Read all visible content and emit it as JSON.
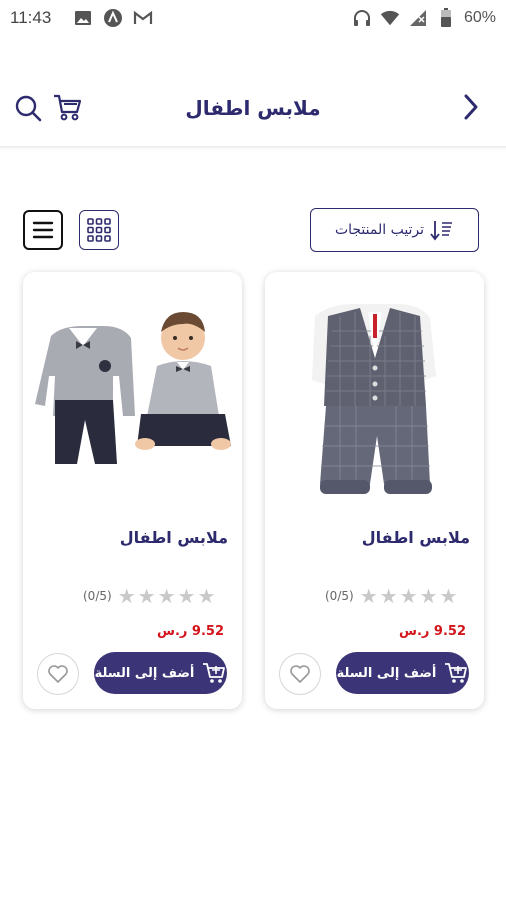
{
  "status_bar": {
    "time": "11:43",
    "battery": "60%"
  },
  "header": {
    "title": "ملابس اطفال"
  },
  "toolbar": {
    "sort_label": "ترتيب المنتجات"
  },
  "products": [
    {
      "name": "ملابس اطفال",
      "rating_count": "(0/5)",
      "rating_value": 0,
      "price": "9.52 ر.س",
      "add_label": "أضف إلى السلة"
    },
    {
      "name": "ملابس اطفال",
      "rating_count": "(0/5)",
      "rating_value": 0,
      "price": "9.52 ر.س",
      "add_label": "أضف إلى السلة"
    }
  ],
  "colors": {
    "brand": "#2d2a6e",
    "button": "#3b3476",
    "price": "#d3141b",
    "star_empty": "#c9c9c9"
  },
  "icons": [
    "image-icon",
    "notification-icon",
    "gmail-icon",
    "headphones-icon",
    "wifi-icon",
    "signal-icon",
    "battery-icon",
    "back-chevron-icon",
    "search-icon",
    "cart-icon",
    "sort-icon",
    "grid-view-icon",
    "list-view-icon",
    "add-to-cart-icon",
    "heart-icon",
    "star-icon"
  ]
}
